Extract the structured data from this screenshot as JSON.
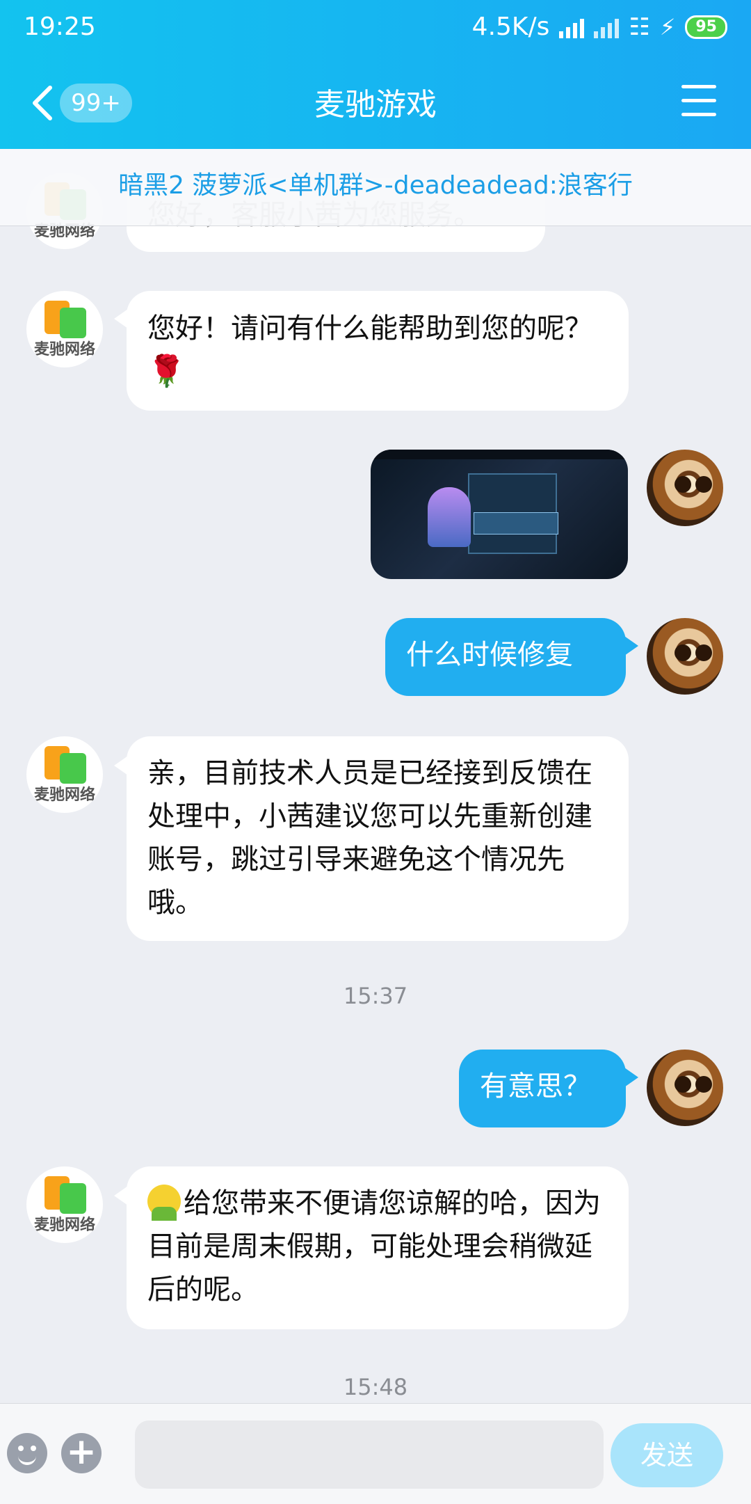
{
  "status_bar": {
    "time": "19:25",
    "network_speed": "4.5K/s",
    "battery": "95"
  },
  "nav": {
    "unread_badge": "99+",
    "title": "麦驰游戏"
  },
  "banner": {
    "text": "暗黑2 菠萝派<单机群>-deadeadead:浪客行"
  },
  "service_logo_text": "麦驰网络",
  "messages": [
    {
      "text": "您好，客服小茜为您服务。"
    },
    {
      "text": "您好！请问有什么能帮助到您的呢？",
      "emoji": "rose"
    },
    {
      "type": "image"
    },
    {
      "text": "什么时候修复"
    },
    {
      "text": "亲，目前技术人员是已经接到反馈在处理中，小茜建议您可以先重新创建账号，跳过引导来避免这个情况先哦。"
    },
    {
      "text": "有意思？"
    },
    {
      "text": "给您带来不便请您谅解的哈，因为目前是周末假期，可能处理会稍微延后的呢。",
      "emoji": "smile"
    }
  ],
  "timestamps": [
    "15:37",
    "15:48"
  ],
  "input_bar": {
    "send_label": "发送"
  },
  "colors": {
    "header": "#1ab6f1",
    "outgoing_bubble": "#21aef0",
    "banner_text": "#1b9ee6"
  }
}
